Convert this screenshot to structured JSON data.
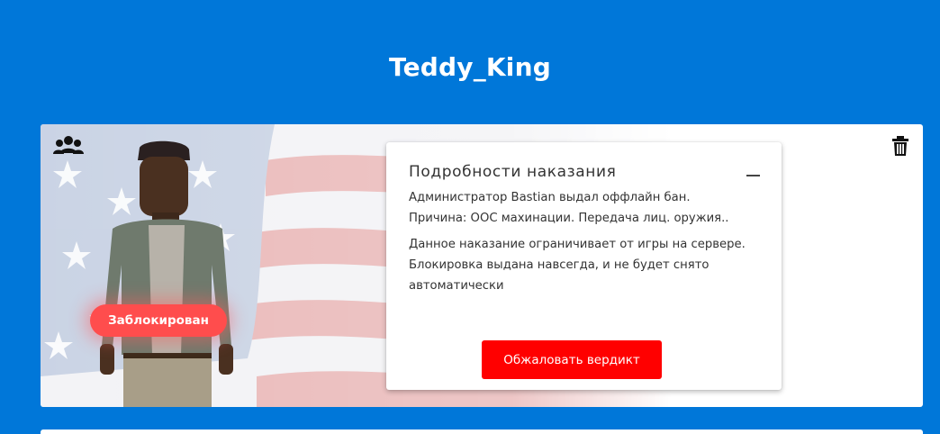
{
  "profile": {
    "username": "Teddy_King",
    "status_badge": "Заблокирован"
  },
  "icons": {
    "group": "group-icon",
    "trash": "trash-icon",
    "collapse": "minus-icon"
  },
  "punishment": {
    "title": "Подробности наказания",
    "line1": "Администратор Bastian выдал оффлайн бан.",
    "line2": "Причина: OOC махинации. Передача лиц. оружия..",
    "note": "Данное наказание ограничивает от игры на сервере. Блокировка выдана навсегда, и не будет снято автоматически",
    "appeal_button": "Обжаловать вердикт"
  },
  "colors": {
    "background": "#0077d9",
    "badge": "#ff4d4d",
    "button": "#ff0000"
  }
}
